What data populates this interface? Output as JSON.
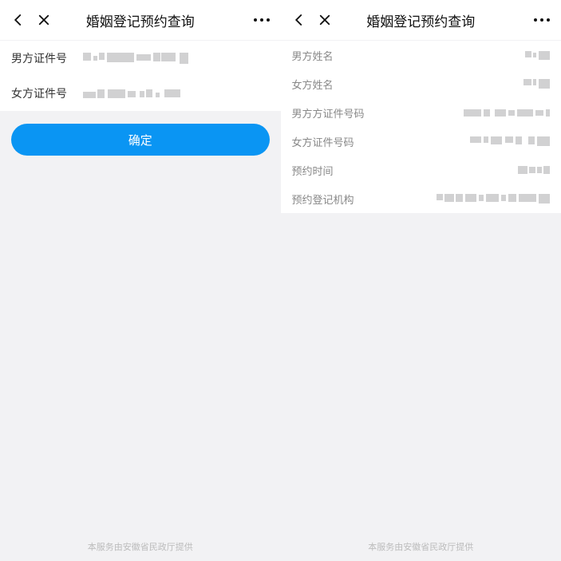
{
  "left": {
    "header": {
      "title": "婚姻登记预约查询"
    },
    "fields": {
      "male_id_label": "男方证件号",
      "female_id_label": "女方证件号"
    },
    "button": "确定",
    "footer": "本服务由安徽省民政厅提供"
  },
  "right": {
    "header": {
      "title": "婚姻登记预约查询"
    },
    "results": {
      "male_name_label": "男方姓名",
      "female_name_label": "女方姓名",
      "male_id_label": "男方方证件号码",
      "female_id_label": "女方证件号码",
      "appt_time_label": "预约时间",
      "appt_office_label": "预约登记机构"
    },
    "footer": "本服务由安徽省民政厅提供"
  }
}
